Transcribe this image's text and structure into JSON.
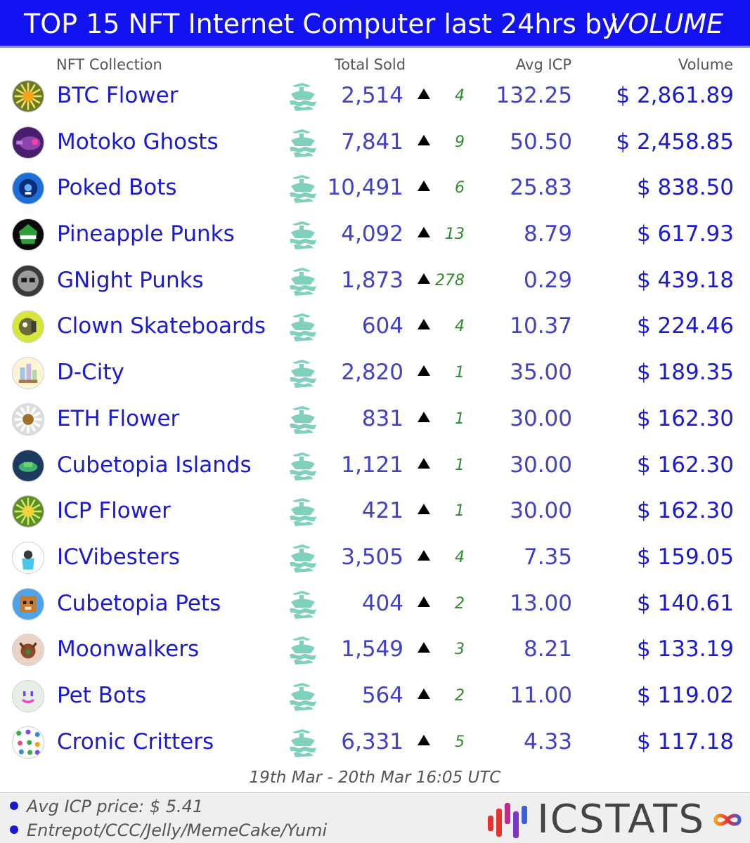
{
  "header": {
    "title": "TOP 15 NFT Internet Computer last 24hrs by",
    "metric": "VOLUME"
  },
  "columns": {
    "collection": "NFT Collection",
    "total_sold": "Total Sold",
    "avg_icp": "Avg ICP",
    "volume": "Volume"
  },
  "rows": [
    {
      "name": "BTC Flower",
      "sold": "2,514",
      "change": "4",
      "avg": "132.25",
      "volume": "$ 2,861.89",
      "logo": "btc-flower-logo-icon"
    },
    {
      "name": "Motoko Ghosts",
      "sold": "7,841",
      "change": "9",
      "avg": "50.50",
      "volume": "$ 2,458.85",
      "logo": "motoko-ghosts-logo-icon"
    },
    {
      "name": "Poked Bots",
      "sold": "10,491",
      "change": "6",
      "avg": "25.83",
      "volume": "$ 838.50",
      "logo": "poked-bots-logo-icon"
    },
    {
      "name": "Pineapple Punks",
      "sold": "4,092",
      "change": "13",
      "avg": "8.79",
      "volume": "$ 617.93",
      "logo": "pineapple-punks-logo-icon"
    },
    {
      "name": "GNight Punks",
      "sold": "1,873",
      "change": "278",
      "avg": "0.29",
      "volume": "$ 439.18",
      "logo": "gnight-punks-logo-icon"
    },
    {
      "name": "Clown Skateboards",
      "sold": "604",
      "change": "4",
      "avg": "10.37",
      "volume": "$ 224.46",
      "logo": "clown-skateboards-logo-icon"
    },
    {
      "name": "D-City",
      "sold": "2,820",
      "change": "1",
      "avg": "35.00",
      "volume": "$ 189.35",
      "logo": "d-city-logo-icon"
    },
    {
      "name": "ETH Flower",
      "sold": "831",
      "change": "1",
      "avg": "30.00",
      "volume": "$ 162.30",
      "logo": "eth-flower-logo-icon"
    },
    {
      "name": "Cubetopia Islands",
      "sold": "1,121",
      "change": "1",
      "avg": "30.00",
      "volume": "$ 162.30",
      "logo": "cubetopia-islands-logo-icon"
    },
    {
      "name": "ICP Flower",
      "sold": "421",
      "change": "1",
      "avg": "30.00",
      "volume": "$ 162.30",
      "logo": "icp-flower-logo-icon"
    },
    {
      "name": "ICVibesters",
      "sold": "3,505",
      "change": "4",
      "avg": "7.35",
      "volume": "$ 159.05",
      "logo": "icvibesters-logo-icon"
    },
    {
      "name": "Cubetopia Pets",
      "sold": "404",
      "change": "2",
      "avg": "13.00",
      "volume": "$ 140.61",
      "logo": "cubetopia-pets-logo-icon"
    },
    {
      "name": "Moonwalkers",
      "sold": "1,549",
      "change": "3",
      "avg": "8.21",
      "volume": "$ 133.19",
      "logo": "moonwalkers-logo-icon"
    },
    {
      "name": "Pet Bots",
      "sold": "564",
      "change": "2",
      "avg": "11.00",
      "volume": "$ 119.02",
      "logo": "pet-bots-logo-icon"
    },
    {
      "name": "Cronic Critters",
      "sold": "6,331",
      "change": "5",
      "avg": "4.33",
      "volume": "$ 117.18",
      "logo": "cronic-critters-logo-icon"
    }
  ],
  "date_range": "19th Mar - 20th Mar 16:05 UTC",
  "footer": {
    "avg_price": "Avg ICP price: $ 5.41",
    "sources": "Entrepot/CCC/Jelly/MemeCake/Yumi",
    "brand": "ICSTATS"
  },
  "icons": {
    "marketplace": "entrepot-ship-icon",
    "trend_up": "triangle-up-icon",
    "bullet": "bullet-dot-icon",
    "brand_mark": "icstats-bars-icon",
    "infinity": "infinity-icon"
  },
  "colors": {
    "header_bg": "#1212f0",
    "link_blue": "#1a1ad2",
    "value_blue": "#4040c8",
    "change_green": "#2e8b2e",
    "ship_teal": "#7fd1bd"
  }
}
